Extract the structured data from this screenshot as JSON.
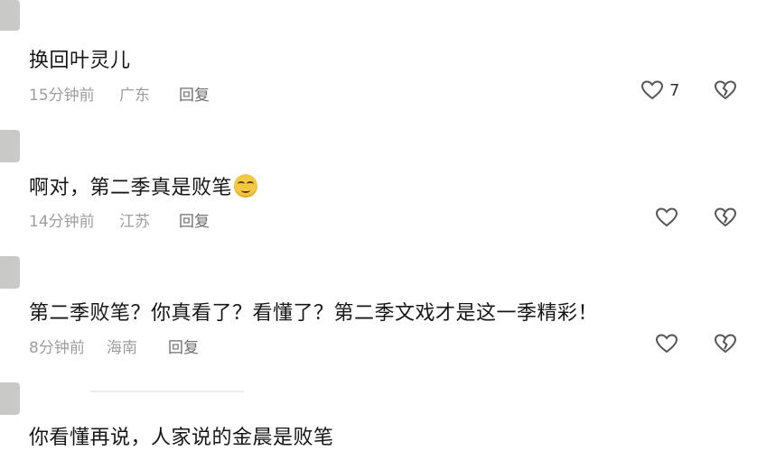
{
  "comments": [
    {
      "text": "换回叶灵儿",
      "time": "15分钟前",
      "location": "广东",
      "reply": "回复",
      "likes": "7"
    },
    {
      "text": "啊对，第二季真是败笔",
      "emoji": "smirk-emoji",
      "time": "14分钟前",
      "location": "江苏",
      "reply": "回复",
      "likes": ""
    },
    {
      "text": "第二季败笔？你真看了？看懂了？第二季文戏才是这一季精彩！",
      "time": "8分钟前",
      "location": "海南",
      "reply": "回复",
      "likes": ""
    },
    {
      "text": "你看懂再说，人家说的金晨是败笔"
    }
  ],
  "icons": {
    "like": "heart-outline-icon",
    "dislike": "broken-heart-icon"
  },
  "colors": {
    "text": "#161616",
    "meta": "#9e9e9e",
    "avatar": "#c9c9c7"
  }
}
